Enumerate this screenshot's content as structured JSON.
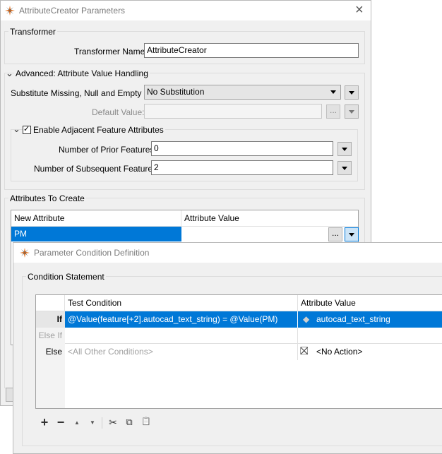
{
  "back_window": {
    "title": "AttributeCreator Parameters",
    "transformer": {
      "group_label": "Transformer",
      "name_label": "Transformer Name:",
      "name_value": "AttributeCreator"
    },
    "advanced": {
      "group_label": "Advanced: Attribute Value Handling",
      "substitute_label": "Substitute Missing, Null and Empty by:",
      "substitute_value": "No Substitution",
      "default_label": "Default Value:",
      "default_value": "",
      "adjacent": {
        "checkbox_label": "Enable Adjacent Feature Attributes",
        "checked": true,
        "prior_label": "Number of Prior Features:",
        "prior_value": "0",
        "subsequent_label": "Number of Subsequent Features:",
        "subsequent_value": "2"
      }
    },
    "attributes": {
      "group_label": "Attributes To Create",
      "columns": [
        "New Attribute",
        "Attribute Value"
      ],
      "rows": [
        {
          "new_attribute": "PM",
          "attribute_value": ""
        }
      ]
    }
  },
  "front_window": {
    "title": "Parameter Condition Definition",
    "group_label": "Condition Statement",
    "columns": [
      "Test Condition",
      "Attribute Value"
    ],
    "rows": [
      {
        "key": "If",
        "condition": "@Value(feature[+2].autocad_text_string) = @Value(PM)",
        "value": "autocad_text_string",
        "selected": true
      },
      {
        "key": "Else If",
        "condition": "",
        "value": "",
        "selected": false
      },
      {
        "key": "Else",
        "condition": "<All Other Conditions>",
        "value": "<No Action>",
        "selected": false
      }
    ],
    "toolbar": {
      "add": "+",
      "remove": "−",
      "up": "▲",
      "down": "▼",
      "cut": "✂",
      "copy": "⧉",
      "paste": "📋"
    }
  },
  "icons": {
    "close": "×",
    "chevron_down": "⌄",
    "dots": "...",
    "check": "✓",
    "attribute_value_icon": "◆",
    "no_action_icon": "⛝"
  },
  "colors": {
    "selection": "#0078d7",
    "window_bg": "#f0f0f0"
  }
}
